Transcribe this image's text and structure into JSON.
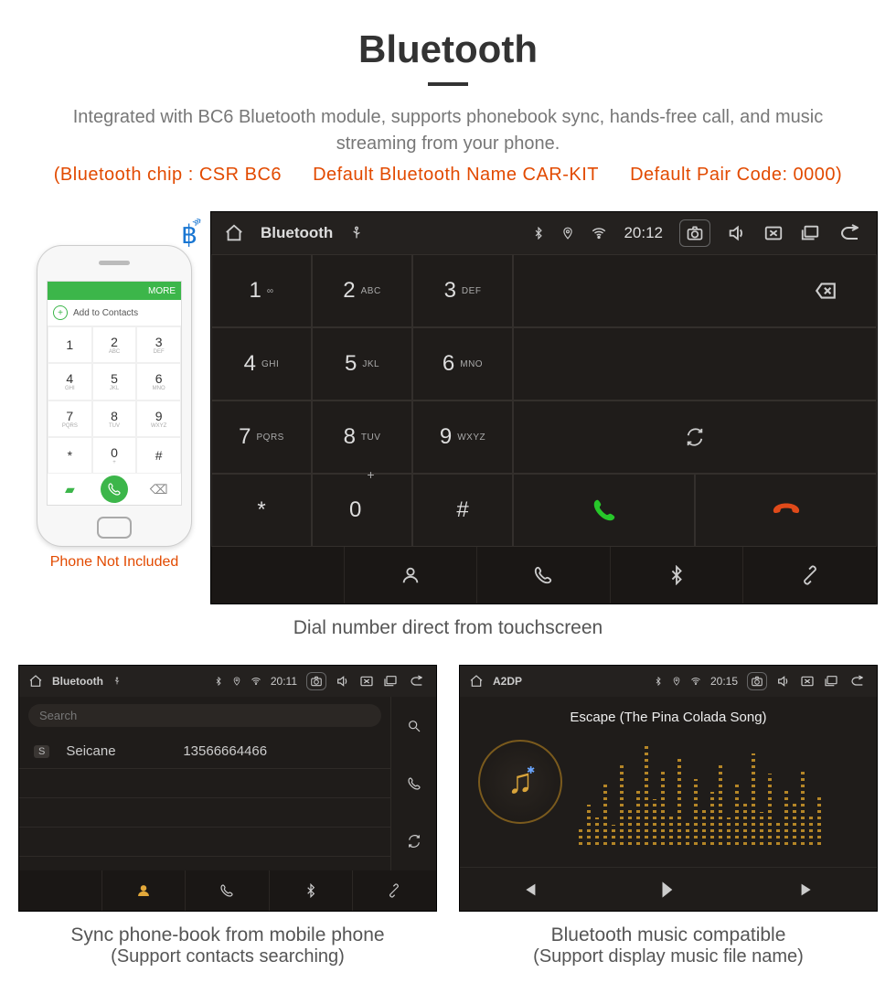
{
  "header": {
    "title": "Bluetooth",
    "desc": "Integrated with BC6 Bluetooth module, supports phonebook sync, hands-free call, and music streaming from your phone.",
    "spec_chip": "(Bluetooth chip : CSR BC6",
    "spec_name": "Default Bluetooth Name CAR-KIT",
    "spec_code": "Default Pair Code: 0000)"
  },
  "phone": {
    "topbar": "MORE",
    "add_contacts": "Add to Contacts",
    "keys": [
      {
        "n": "1",
        "l": ""
      },
      {
        "n": "2",
        "l": "ABC"
      },
      {
        "n": "3",
        "l": "DEF"
      },
      {
        "n": "4",
        "l": "GHI"
      },
      {
        "n": "5",
        "l": "JKL"
      },
      {
        "n": "6",
        "l": "MNO"
      },
      {
        "n": "7",
        "l": "PQRS"
      },
      {
        "n": "8",
        "l": "TUV"
      },
      {
        "n": "9",
        "l": "WXYZ"
      },
      {
        "n": "*",
        "l": ""
      },
      {
        "n": "0",
        "l": "+"
      },
      {
        "n": "#",
        "l": ""
      }
    ],
    "note": "Phone Not Included"
  },
  "unit_main": {
    "title": "Bluetooth",
    "time": "20:12",
    "keys": [
      {
        "n": "1",
        "l": "∞"
      },
      {
        "n": "2",
        "l": "ABC"
      },
      {
        "n": "3",
        "l": "DEF"
      },
      {
        "n": "4",
        "l": "GHI"
      },
      {
        "n": "5",
        "l": "JKL"
      },
      {
        "n": "6",
        "l": "MNO"
      },
      {
        "n": "7",
        "l": "PQRS"
      },
      {
        "n": "8",
        "l": "TUV"
      },
      {
        "n": "9",
        "l": "WXYZ"
      },
      {
        "n": "*",
        "l": ""
      },
      {
        "n": "0",
        "l": ""
      },
      {
        "n": "#",
        "l": ""
      }
    ],
    "zero_sup": "+",
    "caption": "Dial number direct from touchscreen"
  },
  "unit_contacts": {
    "title": "Bluetooth",
    "time": "20:11",
    "search_ph": "Search",
    "contact_badge": "S",
    "contact_name": "Seicane",
    "contact_num": "13566664466",
    "caption_l1": "Sync phone-book from mobile phone",
    "caption_l2": "(Support contacts searching)"
  },
  "unit_music": {
    "title": "A2DP",
    "time": "20:15",
    "track": "Escape (The Pina Colada Song)",
    "caption_l1": "Bluetooth music compatible",
    "caption_l2": "(Support display music file name)"
  }
}
